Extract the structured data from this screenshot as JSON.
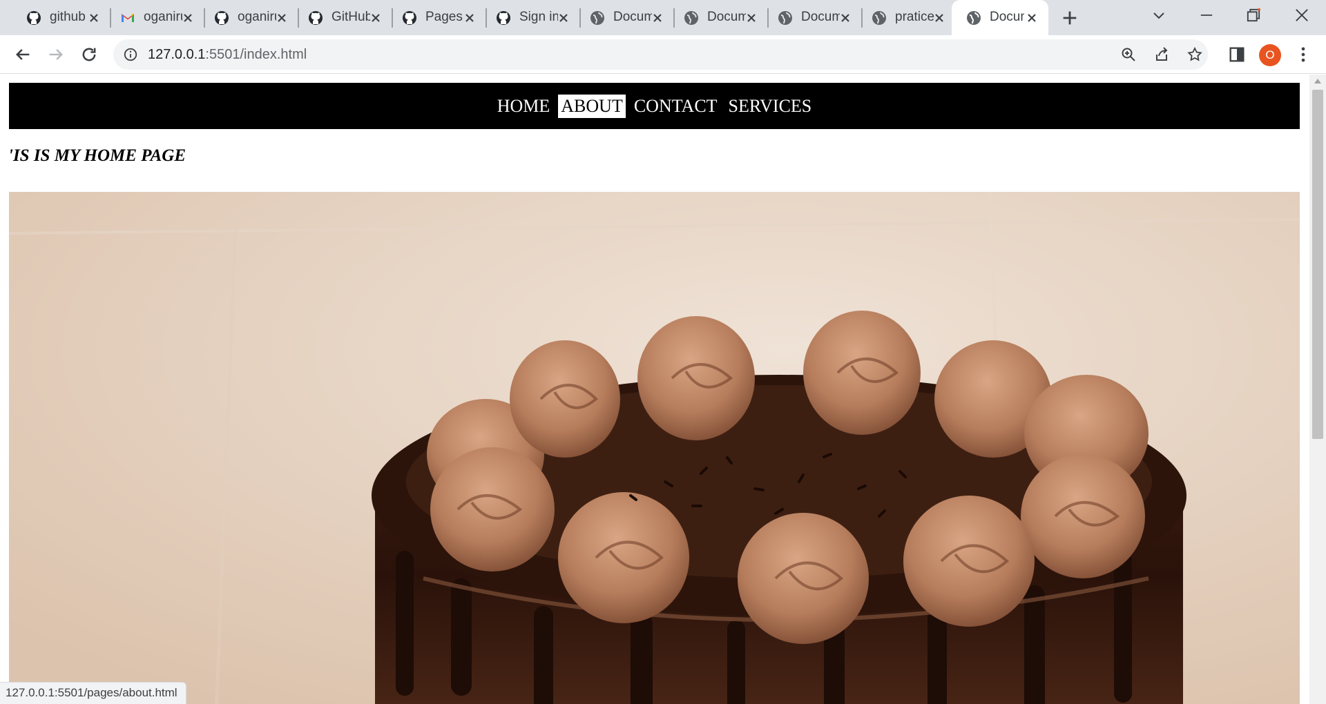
{
  "tabs": [
    {
      "title": "github",
      "icon": "github-icon"
    },
    {
      "title": "oganiru",
      "icon": "gmail-icon"
    },
    {
      "title": "oganiru",
      "icon": "github-icon"
    },
    {
      "title": "GitHub",
      "icon": "github-icon"
    },
    {
      "title": "Pages",
      "icon": "github-icon"
    },
    {
      "title": "Sign in",
      "icon": "github-icon"
    },
    {
      "title": "Document",
      "icon": "globe-icon"
    },
    {
      "title": "Document",
      "icon": "globe-icon"
    },
    {
      "title": "Document",
      "icon": "globe-icon"
    },
    {
      "title": "pratice",
      "icon": "globe-icon"
    },
    {
      "title": "Document",
      "icon": "globe-icon",
      "active": true
    }
  ],
  "address_bar": {
    "host": "127.0.0.1",
    "rest": ":5501/index.html"
  },
  "profile": {
    "initial": "O",
    "color": "#e8541f"
  },
  "page": {
    "nav": {
      "home": "HOME",
      "about": "ABOUT",
      "contact": "CONTACT",
      "services": "SERVICES"
    },
    "heading": "'IS IS MY HOME PAGE",
    "hero_image": "chocolate-cake-photo"
  },
  "status_url": "127.0.0.1:5501/pages/about.html"
}
